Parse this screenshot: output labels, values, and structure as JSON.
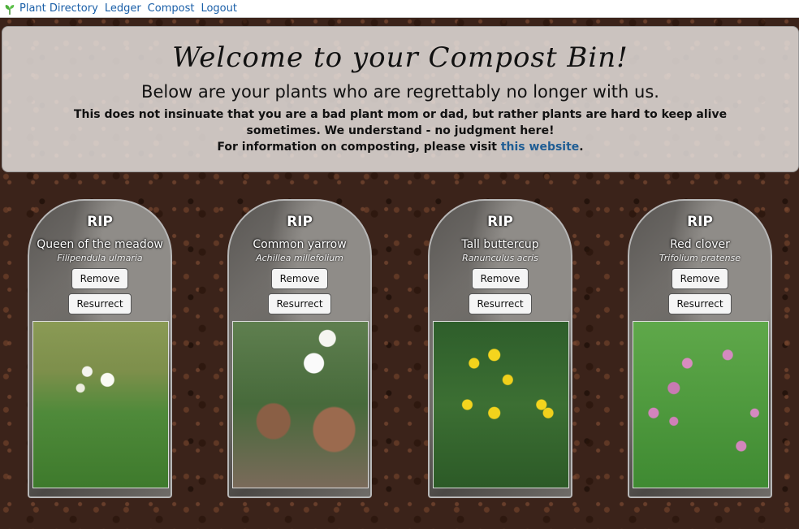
{
  "nav": {
    "items": [
      "Plant Directory",
      "Ledger",
      "Compost",
      "Logout"
    ]
  },
  "banner": {
    "title": "Welcome to your Compost Bin!",
    "subtitle": "Below are your plants who are regrettably no longer with us.",
    "note_line1": "This does not insinuate that you are a bad plant mom or dad, but rather plants are hard to keep alive sometimes. We understand - no judgment here!",
    "note_line2_prefix": "For information on composting, please visit ",
    "note_link": "this website",
    "note_line2_suffix": "."
  },
  "plants": [
    {
      "rip": "RIP",
      "common": "Queen of the meadow",
      "scientific": "Filipendula ulmaria",
      "remove": "Remove",
      "resurrect": "Resurrect"
    },
    {
      "rip": "RIP",
      "common": "Common yarrow",
      "scientific": "Achillea millefolium",
      "remove": "Remove",
      "resurrect": "Resurrect"
    },
    {
      "rip": "RIP",
      "common": "Tall buttercup",
      "scientific": "Ranunculus acris",
      "remove": "Remove",
      "resurrect": "Resurrect"
    },
    {
      "rip": "RIP",
      "common": "Red clover",
      "scientific": "Trifolium pratense",
      "remove": "Remove",
      "resurrect": "Resurrect"
    }
  ],
  "colors": {
    "link": "#1a5fa8",
    "banner_link": "#1f5d94"
  }
}
